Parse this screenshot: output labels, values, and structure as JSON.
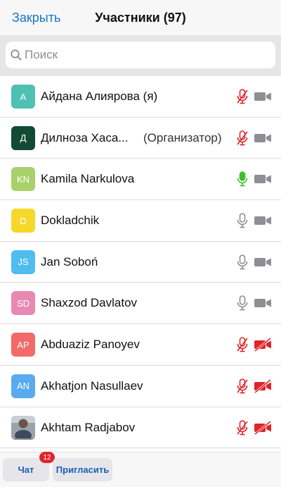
{
  "header": {
    "close_label": "Закрыть",
    "title": "Участники (97)"
  },
  "search": {
    "placeholder": "Поиск",
    "value": ""
  },
  "colors": {
    "accent": "#1a73c9",
    "mic_muted": "#e0242b",
    "mic_active": "#3fbf2e",
    "icon_gray": "#8e8e93"
  },
  "participants": [
    {
      "name": "Айдана Алиярова (я)",
      "role": "",
      "initials": "A",
      "avatar_color": "#4fc1b3",
      "mic": "muted",
      "video": "on",
      "photo": false
    },
    {
      "name": "Дилноза Хаса...",
      "role": "(Организатор)",
      "initials": "Д",
      "avatar_color": "#114a35",
      "mic": "muted",
      "video": "on",
      "photo": false
    },
    {
      "name": "Kamila Narkulova",
      "role": "",
      "initials": "KN",
      "avatar_color": "#a8d16a",
      "mic": "active",
      "video": "on",
      "photo": false
    },
    {
      "name": "Dokladchik",
      "role": "",
      "initials": "D",
      "avatar_color": "#f6d82b",
      "mic": "on",
      "video": "on",
      "photo": false
    },
    {
      "name": "Jan Soboń",
      "role": "",
      "initials": "JS",
      "avatar_color": "#4fbdf0",
      "mic": "on",
      "video": "on",
      "photo": false
    },
    {
      "name": "Shaxzod Davlatov",
      "role": "",
      "initials": "SD",
      "avatar_color": "#e889b3",
      "mic": "on",
      "video": "on",
      "photo": false
    },
    {
      "name": "Abduaziz Panoyev",
      "role": "",
      "initials": "AP",
      "avatar_color": "#f36a6a",
      "mic": "muted",
      "video": "off",
      "photo": false
    },
    {
      "name": "Akhatjon Nasullaev",
      "role": "",
      "initials": "AN",
      "avatar_color": "#5aaaf0",
      "mic": "muted",
      "video": "off",
      "photo": false
    },
    {
      "name": "Akhtam Radjabov",
      "role": "",
      "initials": "",
      "avatar_color": "#8d8d8d",
      "mic": "muted",
      "video": "off",
      "photo": true
    }
  ],
  "footer": {
    "chat_label": "Чат",
    "chat_badge": "12",
    "invite_label": "Пригласить"
  }
}
